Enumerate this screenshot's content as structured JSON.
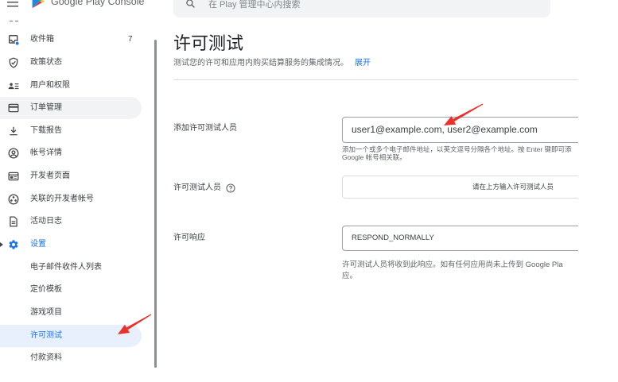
{
  "header": {
    "app_name": "Google Play Console",
    "search_placeholder": "在 Play 管理中心内搜索"
  },
  "sidebar": {
    "items": [
      {
        "label": "收件箱",
        "icon": "inbox-icon",
        "count": "7"
      },
      {
        "label": "政策状态",
        "icon": "shield-check-icon"
      },
      {
        "label": "用户和权限",
        "icon": "manage-accounts-icon"
      },
      {
        "label": "订单管理",
        "icon": "credit-card-icon",
        "hovered": true
      },
      {
        "label": "下载报告",
        "icon": "download-icon"
      },
      {
        "label": "帐号详情",
        "icon": "account-circle-icon"
      },
      {
        "label": "开发者页面",
        "icon": "web-page-icon"
      },
      {
        "label": "关联的开发者帐号",
        "icon": "linked-accounts-icon"
      },
      {
        "label": "活动日志",
        "icon": "document-icon"
      },
      {
        "label": "设置",
        "icon": "settings-gear-icon",
        "expanded": true
      },
      {
        "label": "电子邮件收件人列表"
      },
      {
        "label": "定价模板"
      },
      {
        "label": "游戏项目"
      },
      {
        "label": "许可测试",
        "selected": true
      },
      {
        "label": "付款资料"
      }
    ]
  },
  "main": {
    "title": "许可测试",
    "description": "测试您的许可和应用内购买结算服务的集成情况。",
    "expand_link": "展开",
    "add_testers": {
      "label": "添加许可测试人员",
      "value": "user1@example.com, user2@example.com",
      "helper_lines": [
        "添加一个或多个电子邮件地址，以英文逗号分隔各个地址。按 Enter 键即可添",
        "Google 帐号相关联。"
      ]
    },
    "testers": {
      "label": "许可测试人员",
      "empty_text": "请在上方输入许可测试人员"
    },
    "license_response": {
      "label": "许可响应",
      "value": "RESPOND_NORMALLY",
      "helper_lines": [
        "许可测试人员将收到此响应。如有任何应用尚未上传到 Google Pla",
        "应。"
      ]
    }
  },
  "colors": {
    "accent": "#1a73e8",
    "annotation_arrow": "#e8322b",
    "hover_bg": "#f1f3f4",
    "selected_bg": "#e8f0fe",
    "text": "#3c4043"
  }
}
